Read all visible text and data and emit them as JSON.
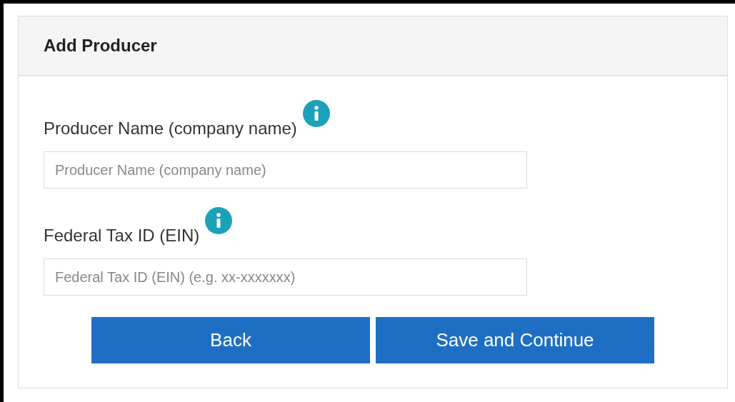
{
  "panel": {
    "title": "Add Producer"
  },
  "fields": [
    {
      "label": "Producer Name (company name)",
      "placeholder": "Producer Name (company name)",
      "info": true
    },
    {
      "label": "Federal Tax ID (EIN)",
      "placeholder": "Federal Tax ID (EIN) (e.g. xx-xxxxxxx)",
      "info": true
    }
  ],
  "buttons": [
    "Back",
    "Save and Continue"
  ]
}
